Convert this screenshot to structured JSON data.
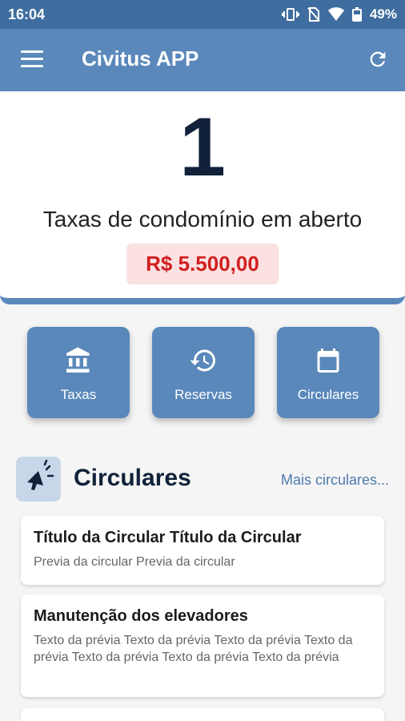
{
  "status_bar": {
    "time": "16:04",
    "battery": "49%"
  },
  "app_bar": {
    "title": "Civitus APP"
  },
  "summary": {
    "count": "1",
    "label": "Taxas de condomínio em aberto",
    "amount": "R$ 5.500,00"
  },
  "tiles": [
    {
      "label": "Taxas",
      "icon": "bank-icon"
    },
    {
      "label": "Reservas",
      "icon": "history-icon"
    },
    {
      "label": "Circulares",
      "icon": "calendar-icon"
    }
  ],
  "circulares": {
    "title": "Circulares",
    "more_link": "Mais circulares...",
    "icon": "megaphone-icon",
    "items": [
      {
        "title": "Título da Circular Título da Circular",
        "preview": "Previa da circular Previa da circular"
      },
      {
        "title": "Manutenção dos elevadores",
        "preview": "Texto da prévia Texto da prévia Texto da prévia Texto da prévia Texto da prévia Texto da prévia Texto da prévia"
      }
    ]
  },
  "colors": {
    "primary": "#5a88bb",
    "status_bar": "#3f6d9f",
    "amount_text": "#d11f1f",
    "amount_bg": "#fbe1e1"
  }
}
